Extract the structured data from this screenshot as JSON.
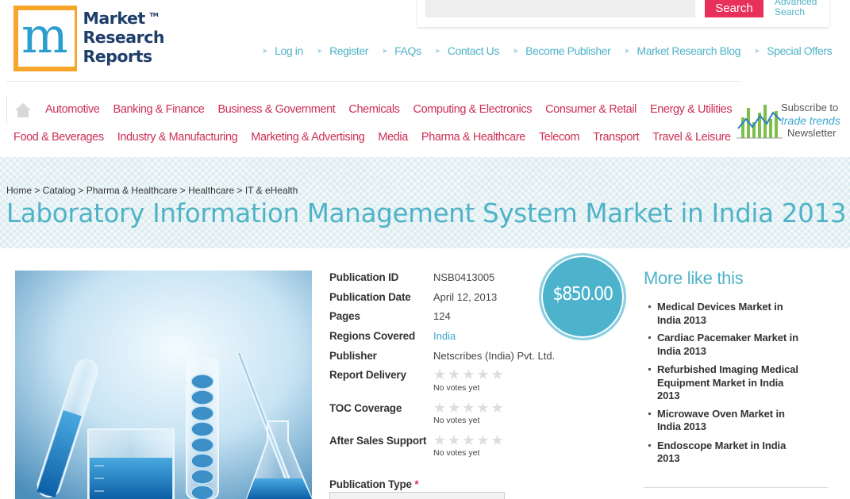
{
  "logo": {
    "line1": "Market",
    "line2": "Research",
    "line3": "Reports",
    "tm": "TM"
  },
  "search": {
    "button": "Search",
    "advanced_line1": "Advanced",
    "advanced_line2": "Search"
  },
  "topnav": [
    "Log in",
    "Register",
    "FAQs",
    "Contact Us",
    "Become Publisher",
    "Market Research Blog",
    "Special Offers"
  ],
  "categories_row1": [
    "Automotive",
    "Banking & Finance",
    "Business & Government",
    "Chemicals",
    "Computing & Electronics",
    "Consumer & Retail",
    "Energy & Utilities"
  ],
  "categories_row2": [
    "Food & Beverages",
    "Industry & Manufacturing",
    "Marketing & Advertising",
    "Media",
    "Pharma & Healthcare",
    "Telecom",
    "Transport",
    "Travel & Leisure"
  ],
  "subscribe": {
    "line1": "Subscribe to",
    "line2": "trade trends",
    "line3": "Newsletter"
  },
  "breadcrumb": "Home > Catalog > Pharma & Healthcare > Healthcare > IT & eHealth",
  "title": "Laboratory Information Management System Market in India 2013",
  "price": "$850.00",
  "details": {
    "publication_id": {
      "label": "Publication ID",
      "value": "NSB0413005"
    },
    "publication_date": {
      "label": "Publication Date",
      "value": "April 12, 2013"
    },
    "pages": {
      "label": "Pages",
      "value": "124"
    },
    "regions": {
      "label": "Regions Covered",
      "value": "India"
    },
    "publisher": {
      "label": "Publisher",
      "value": "Netscribes (India) Pvt. Ltd."
    },
    "report_delivery": {
      "label": "Report Delivery",
      "votes": "No votes yet",
      "rating": 0
    },
    "toc_coverage": {
      "label": "TOC Coverage",
      "votes": "No votes yet",
      "rating": 0
    },
    "after_sales": {
      "label": "After Sales Support",
      "votes": "No votes yet",
      "rating": 0
    },
    "publication_type": {
      "label": "Publication Type",
      "required": "*"
    }
  },
  "more": {
    "title": "More like this",
    "items": [
      {
        "line1": "Medical Devices Market in",
        "line2": "India 2013"
      },
      {
        "line1": "Cardiac Pacemaker Market in",
        "line2": "India 2013"
      },
      {
        "line1": "Refurbished Imaging Medical",
        "line2": "Equipment Market in India",
        "line3": "2013"
      },
      {
        "line1": "Microwave Oven Market in",
        "line2": "India 2013"
      },
      {
        "line1": "Endoscope Market in India",
        "line2": "2013"
      }
    ]
  },
  "colors": {
    "accent_teal": "#4fb3c8",
    "category_red": "#cd2f55",
    "search_pink": "#e8305a",
    "price_circle": "#4db3cd",
    "logo_orange": "#f7a52b"
  },
  "icons": [
    "home-icon",
    "arrow-bullet-icon",
    "star-icon",
    "newsletter-chart-icon"
  ]
}
